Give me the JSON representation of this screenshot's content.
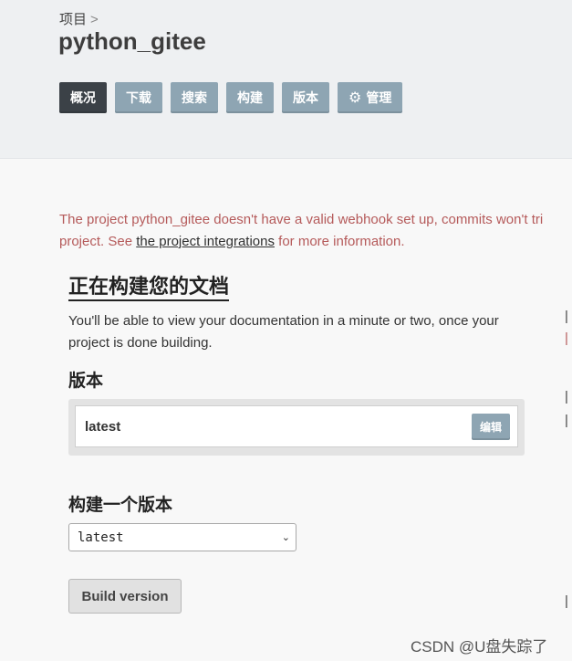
{
  "breadcrumb": {
    "label": "项目",
    "separator": ">"
  },
  "project_title": "python_gitee",
  "tabs": [
    {
      "label": "概况",
      "active": true
    },
    {
      "label": "下载"
    },
    {
      "label": "搜索"
    },
    {
      "label": "构建"
    },
    {
      "label": "版本"
    },
    {
      "label": "管理",
      "icon": "gear-icon"
    }
  ],
  "warning": {
    "line1": "The project python_gitee doesn't have a valid webhook set up, commits won't tri",
    "line2_prefix": "project. See ",
    "link": "the project integrations",
    "line2_suffix": " for more information."
  },
  "building": {
    "heading": "正在构建您的文档",
    "description": "You'll be able to view your documentation in a minute or two, once your project is done building."
  },
  "versions": {
    "heading": "版本",
    "items": [
      {
        "name": "latest",
        "edit_label": "编辑"
      }
    ]
  },
  "build": {
    "heading": "构建一个版本",
    "selected": "latest",
    "button": "Build version"
  },
  "watermark": "CSDN @U盘失踪了",
  "colors": {
    "tab": "#8ea5b3",
    "tab_active": "#3b4147",
    "warning_text": "#b55a5a"
  }
}
